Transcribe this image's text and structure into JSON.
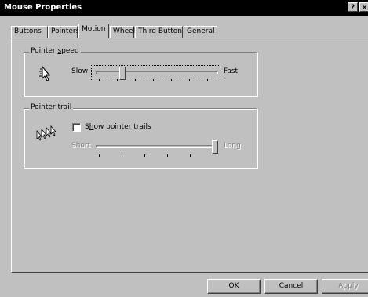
{
  "window": {
    "title": "Mouse Properties",
    "help_glyph": "?",
    "close_glyph": "×"
  },
  "tabs": [
    "Buttons",
    "Pointers",
    "Motion",
    "Wheel",
    "Third Button",
    "General"
  ],
  "active_tab": "Motion",
  "pointer_speed": {
    "legend_pre": "Pointer ",
    "legend_key": "s",
    "legend_post": "peed",
    "slow_label": "Slow",
    "fast_label": "Fast",
    "value_fraction": 0.2,
    "icon": "pointer-speed-icon"
  },
  "pointer_trail": {
    "legend_pre": "Pointer ",
    "legend_key": "t",
    "legend_post": "rail",
    "checkbox_pre": "S",
    "checkbox_key": "h",
    "checkbox_post": "ow pointer trails",
    "checked": false,
    "short_label": "Short",
    "long_label": "Long",
    "value_fraction": 1.0,
    "icon": "pointer-trail-icon"
  },
  "buttons": {
    "ok": "OK",
    "cancel": "Cancel",
    "apply": "Apply"
  }
}
